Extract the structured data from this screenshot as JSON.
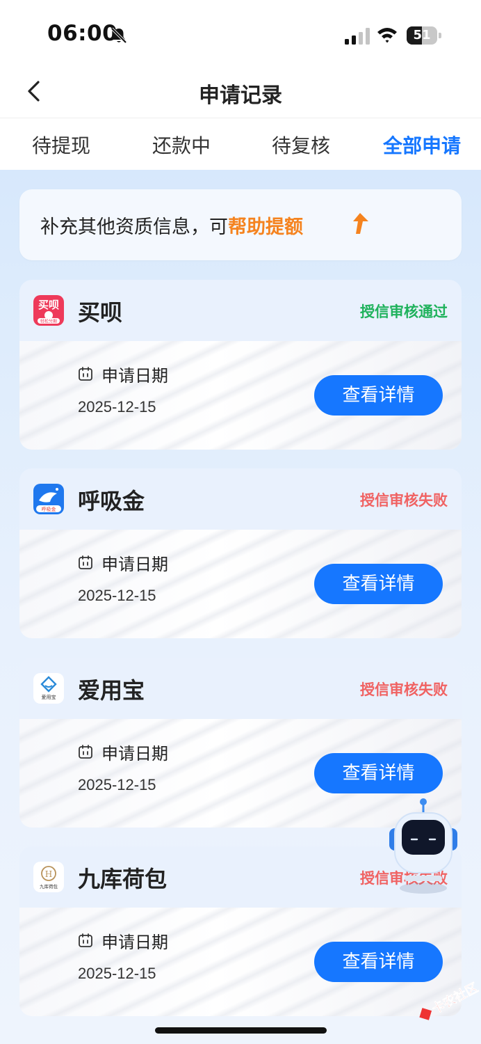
{
  "status_bar": {
    "time": "06:00",
    "battery": "51",
    "battery_level": 0.51
  },
  "nav": {
    "title": "申请记录"
  },
  "tabs": [
    {
      "label": "待提现",
      "active": false
    },
    {
      "label": "还款中",
      "active": false
    },
    {
      "label": "待复核",
      "active": false
    },
    {
      "label": "全部申请",
      "active": true
    }
  ],
  "promo": {
    "text": "补充其他资质信息，可",
    "highlight": "帮助提额"
  },
  "records": [
    {
      "app_name": "买呗",
      "logo_text": "买呗",
      "logo_sub": "轻松分期",
      "status": "授信审核通过",
      "status_type": "pass",
      "date_label": "申请日期",
      "date": "2025-12-15",
      "button": "查看详情"
    },
    {
      "app_name": "呼吸金",
      "logo_text": "呼吸金",
      "status": "授信审核失败",
      "status_type": "fail",
      "date_label": "申请日期",
      "date": "2025-12-15",
      "button": "查看详情"
    },
    {
      "app_name": "爱用宝",
      "logo_text": "爱用宝",
      "status": "授信审核失败",
      "status_type": "fail",
      "date_label": "申请日期",
      "date": "2025-12-15",
      "button": "查看详情"
    },
    {
      "app_name": "九库荷包",
      "logo_text": "九库荷包",
      "status": "授信审核失败",
      "status_type": "fail",
      "date_label": "申请日期",
      "date": "2025-12-15",
      "button": "查看详情"
    }
  ],
  "watermark": "卡农社区",
  "colors": {
    "primary": "#1677ff",
    "pass": "#1fb25c",
    "fail": "#f06262",
    "highlight": "#f5831f"
  }
}
